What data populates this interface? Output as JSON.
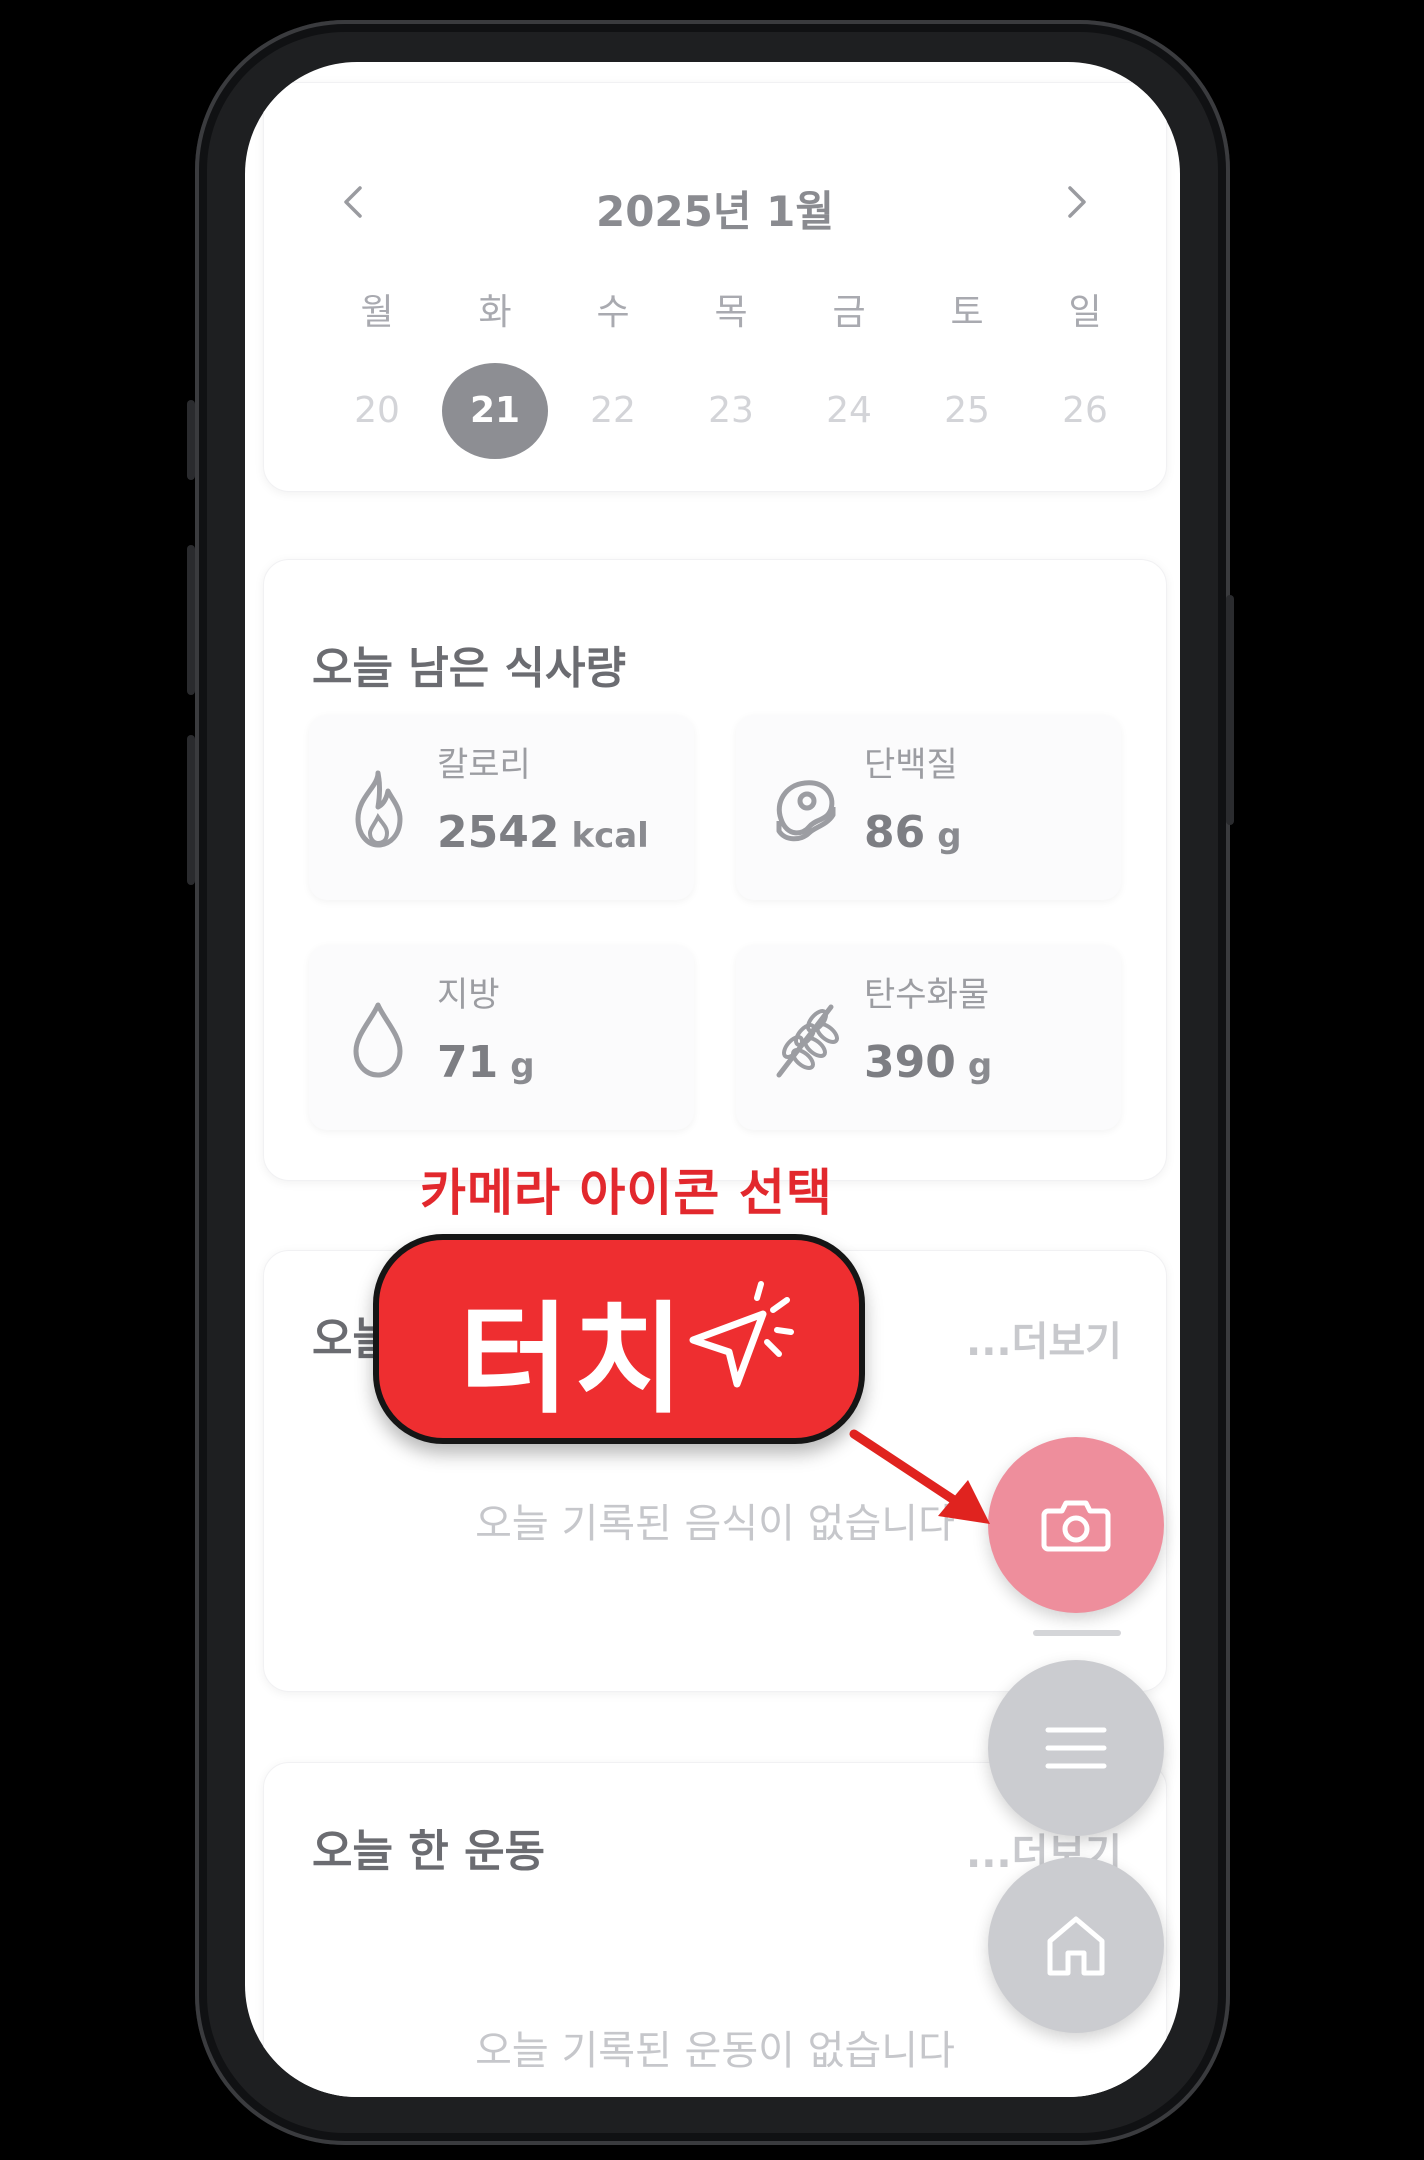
{
  "calendar": {
    "title": "2025년 1월",
    "weekdays": [
      "월",
      "화",
      "수",
      "목",
      "금",
      "토",
      "일"
    ],
    "dates": [
      "20",
      "21",
      "22",
      "23",
      "24",
      "25",
      "26"
    ],
    "selected_date": "21"
  },
  "remaining": {
    "title": "오늘 남은 식사량",
    "items": [
      {
        "label": "칼로리",
        "value": "2542",
        "unit": "kcal",
        "icon": "flame-icon"
      },
      {
        "label": "단백질",
        "value": "86",
        "unit": "g",
        "icon": "meat-icon"
      },
      {
        "label": "지방",
        "value": "71",
        "unit": "g",
        "icon": "drop-icon"
      },
      {
        "label": "탄수화물",
        "value": "390",
        "unit": "g",
        "icon": "wheat-icon"
      }
    ]
  },
  "food": {
    "title": "오늘 먹은 음식",
    "more": "...더보기",
    "empty": "오늘 기록된 음식이 없습니다"
  },
  "exercise": {
    "title": "오늘 한 운동",
    "more": "...더보기",
    "empty": "오늘 기록된 운동이 없습니다"
  },
  "fabs": {
    "camera_icon": "camera-icon",
    "menu_icon": "menu-icon",
    "home_icon": "home-icon"
  },
  "annotation": {
    "instruction": "카메라 아이콘 선택",
    "touch_label": "터치"
  },
  "colors": {
    "camera_fab": "#ee8e9c",
    "secondary_fab": "#cbccd0",
    "selected_date": "#8d8e93",
    "annotation_red": "#ee2e30"
  }
}
